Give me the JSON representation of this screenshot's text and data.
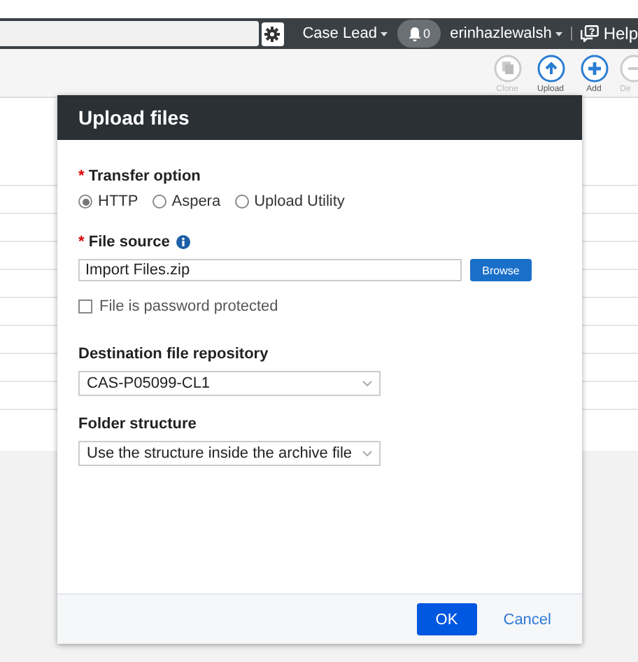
{
  "header": {
    "role": "Case Lead",
    "notifications": "0",
    "user": "erinhazlewalsh",
    "help": "Help"
  },
  "toolbar": {
    "buttons": [
      {
        "kind": "clone",
        "label": "Clone",
        "disabled": true
      },
      {
        "kind": "upload",
        "label": "Upload",
        "disabled": false
      },
      {
        "kind": "add",
        "label": "Add",
        "disabled": false
      },
      {
        "kind": "delete",
        "label": "De",
        "disabled": true
      }
    ]
  },
  "dialog": {
    "title": "Upload files",
    "transfer_option": {
      "label": "Transfer option",
      "required_mark": "*",
      "options": [
        {
          "label": "HTTP",
          "selected": true
        },
        {
          "label": "Aspera",
          "selected": false
        },
        {
          "label": "Upload Utility",
          "selected": false
        }
      ]
    },
    "file_source": {
      "label": "File source",
      "required_mark": "*",
      "value": "Import Files.zip",
      "browse": "Browse"
    },
    "password_protected": {
      "label": "File is password protected",
      "checked": false
    },
    "destination": {
      "label": "Destination file repository",
      "value": "CAS-P05099-CL1"
    },
    "folder_structure": {
      "label": "Folder structure",
      "value": "Use the structure inside the archive file"
    },
    "ok": "OK",
    "cancel": "Cancel"
  }
}
